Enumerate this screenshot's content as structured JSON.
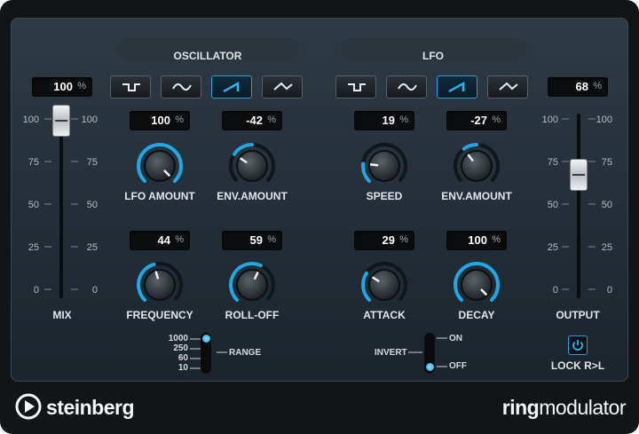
{
  "sections": {
    "oscillator": "OSCILLATOR",
    "lfo": "LFO"
  },
  "mix": {
    "label": "MIX",
    "value": "100",
    "unit": "%",
    "level_percent": 100,
    "scale_left": [
      "100",
      "75",
      "50",
      "25",
      "0"
    ],
    "scale_right": [
      "100",
      "75",
      "50",
      "25",
      "0"
    ]
  },
  "output": {
    "label": "OUTPUT",
    "value": "68",
    "unit": "%",
    "level_percent": 68,
    "scale_left": [
      "100",
      "75",
      "50",
      "25",
      "0"
    ],
    "scale_right": [
      "100",
      "75",
      "50",
      "25",
      "0"
    ]
  },
  "oscillator": {
    "waveforms": [
      "square-wave-icon",
      "sine-wave-icon",
      "sawtooth-wave-icon",
      "triangle-wave-icon"
    ],
    "active_waveform": "sawtooth-wave-icon",
    "lfo_amount": {
      "label": "LFO AMOUNT",
      "value": "100",
      "unit": "%"
    },
    "env_amount": {
      "label": "ENV.AMOUNT",
      "value": "-42",
      "unit": "%"
    },
    "frequency": {
      "label": "FREQUENCY",
      "value": "44",
      "unit": "%"
    },
    "roll_off": {
      "label": "ROLL-OFF",
      "value": "59",
      "unit": "%"
    },
    "range": {
      "label": "RANGE",
      "options": [
        "1000",
        "250",
        "60",
        "10"
      ],
      "selected": "1000"
    }
  },
  "lfo": {
    "waveforms": [
      "square-wave-icon",
      "sine-wave-icon",
      "sawtooth-wave-icon",
      "triangle-wave-icon"
    ],
    "active_waveform": "sawtooth-wave-icon",
    "speed": {
      "label": "SPEED",
      "value": "19",
      "unit": "%"
    },
    "env_amount": {
      "label": "ENV.AMOUNT",
      "value": "-27",
      "unit": "%"
    },
    "attack": {
      "label": "ATTACK",
      "value": "29",
      "unit": "%"
    },
    "decay": {
      "label": "DECAY",
      "value": "100",
      "unit": "%"
    },
    "invert": {
      "label": "INVERT",
      "on": "ON",
      "off": "OFF",
      "selected": "OFF"
    }
  },
  "lock": {
    "label": "LOCK R>L",
    "icon": "power-icon"
  },
  "footer": {
    "brand": "steinberg",
    "brand_icon": "steinberg-logo-icon",
    "product_bold": "ring",
    "product_rest": "modulator"
  },
  "colors": {
    "accent": "#1fa8e6",
    "panel": "#2a3640",
    "display_bg": "#0a0c0e"
  }
}
